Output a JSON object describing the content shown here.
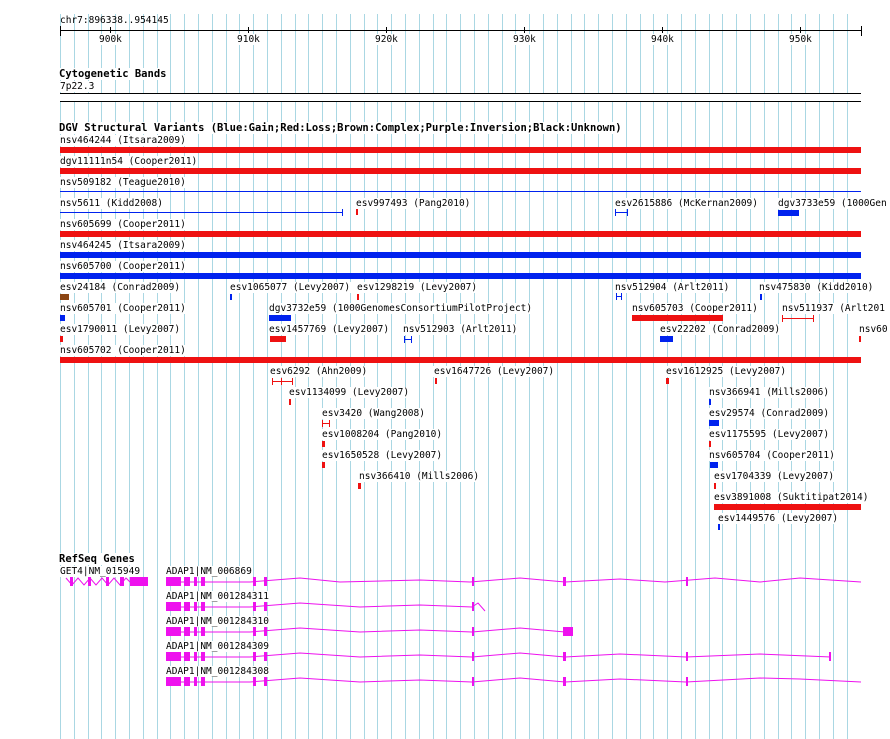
{
  "ruler": {
    "range_label": "chr7:896338..954145",
    "ticks": [
      "900k",
      "910k",
      "920k",
      "930k",
      "940k",
      "950k"
    ]
  },
  "cytoband": {
    "title": "Cytogenetic Bands",
    "band": "7p22.3"
  },
  "dgv": {
    "title": "DGV Structural Variants (Blue:Gain;Red:Loss;Brown:Complex;Purple:Inversion;Black:Unknown)",
    "colors": {
      "gain": "#0022ee",
      "loss": "#ee1111",
      "complex": "#8b4513"
    },
    "labels": [
      "nsv464244 (Itsara2009)",
      "dgv11111n54 (Cooper2011)",
      "nsv509182 (Teague2010)",
      "nsv5611 (Kidd2008)",
      "esv997493 (Pang2010)",
      "esv2615886 (McKernan2009)",
      "dgv3733e59 (1000Gen",
      "nsv605699 (Cooper2011)",
      "nsv464245 (Itsara2009)",
      "nsv605700 (Cooper2011)",
      "esv24184 (Conrad2009)",
      "esv1065077 (Levy2007)",
      "esv1298219 (Levy2007)",
      "nsv512904 (Arlt2011)",
      "nsv475830 (Kidd2010)",
      "nsv605701 (Cooper2011)",
      "dgv3732e59 (1000GenomesConsortiumPilotProject)",
      "nsv605703 (Cooper2011)",
      "nsv511937 (Arlt201",
      "esv1790011 (Levy2007)",
      "esv1457769 (Levy2007)",
      "nsv512903 (Arlt2011)",
      "esv22202 (Conrad2009)",
      "nsv60",
      "nsv605702 (Cooper2011)",
      "esv6292 (Ahn2009)",
      "esv1647726 (Levy2007)",
      "esv1612925 (Levy2007)",
      "esv1134099 (Levy2007)",
      "nsv366941 (Mills2006)",
      "esv3420 (Wang2008)",
      "esv29574 (Conrad2009)",
      "esv1008204 (Pang2010)",
      "esv1175595 (Levy2007)",
      "esv1650528 (Levy2007)",
      "nsv605704 (Cooper2011)",
      "nsv366410 (Mills2006)",
      "esv1704339 (Levy2007)",
      "esv3891008 (Suktitipat2014)",
      "esv1449576 (Levy2007)"
    ]
  },
  "refseq": {
    "title": "RefSeq Genes",
    "gene_color": "#ee11ee",
    "labels": [
      "GET4|NM_015949",
      "ADAP1|NM_006869",
      "ADAP1|NM_001284311",
      "ADAP1|NM_001284310",
      "ADAP1|NM_001284309",
      "ADAP1|NM_001284308"
    ]
  }
}
